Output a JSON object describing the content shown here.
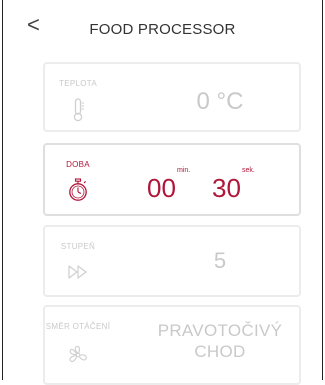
{
  "header": {
    "back_label": "<",
    "title": "FOOD PROCESSOR"
  },
  "cards": {
    "temperature": {
      "label": "TEPLOTA",
      "value": "0 °C",
      "icon": "thermometer-icon",
      "state": "disabled"
    },
    "time": {
      "label": "DOBA",
      "minutes": "00",
      "minutes_unit": "min.",
      "seconds": "30",
      "seconds_unit": "sek.",
      "icon": "stopwatch-icon",
      "state": "active"
    },
    "level": {
      "label": "STUPEŇ",
      "value": "5",
      "icon": "fast-forward-icon",
      "state": "disabled"
    },
    "direction": {
      "label": "SMĚR OTÁČENÍ",
      "value_line1": "PRAVOTOČIVÝ",
      "value_line2": "CHOD",
      "icon": "fan-icon",
      "state": "disabled"
    }
  },
  "colors": {
    "accent": "#b0163a",
    "inactive_text": "#c9c9c9",
    "card_border": "#ececec"
  }
}
